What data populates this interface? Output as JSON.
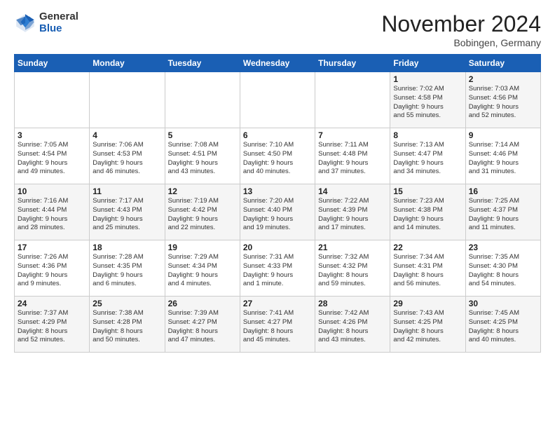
{
  "header": {
    "logo_general": "General",
    "logo_blue": "Blue",
    "month_title": "November 2024",
    "location": "Bobingen, Germany"
  },
  "weekdays": [
    "Sunday",
    "Monday",
    "Tuesday",
    "Wednesday",
    "Thursday",
    "Friday",
    "Saturday"
  ],
  "weeks": [
    [
      {
        "day": "",
        "info": ""
      },
      {
        "day": "",
        "info": ""
      },
      {
        "day": "",
        "info": ""
      },
      {
        "day": "",
        "info": ""
      },
      {
        "day": "",
        "info": ""
      },
      {
        "day": "1",
        "info": "Sunrise: 7:02 AM\nSunset: 4:58 PM\nDaylight: 9 hours\nand 55 minutes."
      },
      {
        "day": "2",
        "info": "Sunrise: 7:03 AM\nSunset: 4:56 PM\nDaylight: 9 hours\nand 52 minutes."
      }
    ],
    [
      {
        "day": "3",
        "info": "Sunrise: 7:05 AM\nSunset: 4:54 PM\nDaylight: 9 hours\nand 49 minutes."
      },
      {
        "day": "4",
        "info": "Sunrise: 7:06 AM\nSunset: 4:53 PM\nDaylight: 9 hours\nand 46 minutes."
      },
      {
        "day": "5",
        "info": "Sunrise: 7:08 AM\nSunset: 4:51 PM\nDaylight: 9 hours\nand 43 minutes."
      },
      {
        "day": "6",
        "info": "Sunrise: 7:10 AM\nSunset: 4:50 PM\nDaylight: 9 hours\nand 40 minutes."
      },
      {
        "day": "7",
        "info": "Sunrise: 7:11 AM\nSunset: 4:48 PM\nDaylight: 9 hours\nand 37 minutes."
      },
      {
        "day": "8",
        "info": "Sunrise: 7:13 AM\nSunset: 4:47 PM\nDaylight: 9 hours\nand 34 minutes."
      },
      {
        "day": "9",
        "info": "Sunrise: 7:14 AM\nSunset: 4:46 PM\nDaylight: 9 hours\nand 31 minutes."
      }
    ],
    [
      {
        "day": "10",
        "info": "Sunrise: 7:16 AM\nSunset: 4:44 PM\nDaylight: 9 hours\nand 28 minutes."
      },
      {
        "day": "11",
        "info": "Sunrise: 7:17 AM\nSunset: 4:43 PM\nDaylight: 9 hours\nand 25 minutes."
      },
      {
        "day": "12",
        "info": "Sunrise: 7:19 AM\nSunset: 4:42 PM\nDaylight: 9 hours\nand 22 minutes."
      },
      {
        "day": "13",
        "info": "Sunrise: 7:20 AM\nSunset: 4:40 PM\nDaylight: 9 hours\nand 19 minutes."
      },
      {
        "day": "14",
        "info": "Sunrise: 7:22 AM\nSunset: 4:39 PM\nDaylight: 9 hours\nand 17 minutes."
      },
      {
        "day": "15",
        "info": "Sunrise: 7:23 AM\nSunset: 4:38 PM\nDaylight: 9 hours\nand 14 minutes."
      },
      {
        "day": "16",
        "info": "Sunrise: 7:25 AM\nSunset: 4:37 PM\nDaylight: 9 hours\nand 11 minutes."
      }
    ],
    [
      {
        "day": "17",
        "info": "Sunrise: 7:26 AM\nSunset: 4:36 PM\nDaylight: 9 hours\nand 9 minutes."
      },
      {
        "day": "18",
        "info": "Sunrise: 7:28 AM\nSunset: 4:35 PM\nDaylight: 9 hours\nand 6 minutes."
      },
      {
        "day": "19",
        "info": "Sunrise: 7:29 AM\nSunset: 4:34 PM\nDaylight: 9 hours\nand 4 minutes."
      },
      {
        "day": "20",
        "info": "Sunrise: 7:31 AM\nSunset: 4:33 PM\nDaylight: 9 hours\nand 1 minute."
      },
      {
        "day": "21",
        "info": "Sunrise: 7:32 AM\nSunset: 4:32 PM\nDaylight: 8 hours\nand 59 minutes."
      },
      {
        "day": "22",
        "info": "Sunrise: 7:34 AM\nSunset: 4:31 PM\nDaylight: 8 hours\nand 56 minutes."
      },
      {
        "day": "23",
        "info": "Sunrise: 7:35 AM\nSunset: 4:30 PM\nDaylight: 8 hours\nand 54 minutes."
      }
    ],
    [
      {
        "day": "24",
        "info": "Sunrise: 7:37 AM\nSunset: 4:29 PM\nDaylight: 8 hours\nand 52 minutes."
      },
      {
        "day": "25",
        "info": "Sunrise: 7:38 AM\nSunset: 4:28 PM\nDaylight: 8 hours\nand 50 minutes."
      },
      {
        "day": "26",
        "info": "Sunrise: 7:39 AM\nSunset: 4:27 PM\nDaylight: 8 hours\nand 47 minutes."
      },
      {
        "day": "27",
        "info": "Sunrise: 7:41 AM\nSunset: 4:27 PM\nDaylight: 8 hours\nand 45 minutes."
      },
      {
        "day": "28",
        "info": "Sunrise: 7:42 AM\nSunset: 4:26 PM\nDaylight: 8 hours\nand 43 minutes."
      },
      {
        "day": "29",
        "info": "Sunrise: 7:43 AM\nSunset: 4:25 PM\nDaylight: 8 hours\nand 42 minutes."
      },
      {
        "day": "30",
        "info": "Sunrise: 7:45 AM\nSunset: 4:25 PM\nDaylight: 8 hours\nand 40 minutes."
      }
    ]
  ]
}
